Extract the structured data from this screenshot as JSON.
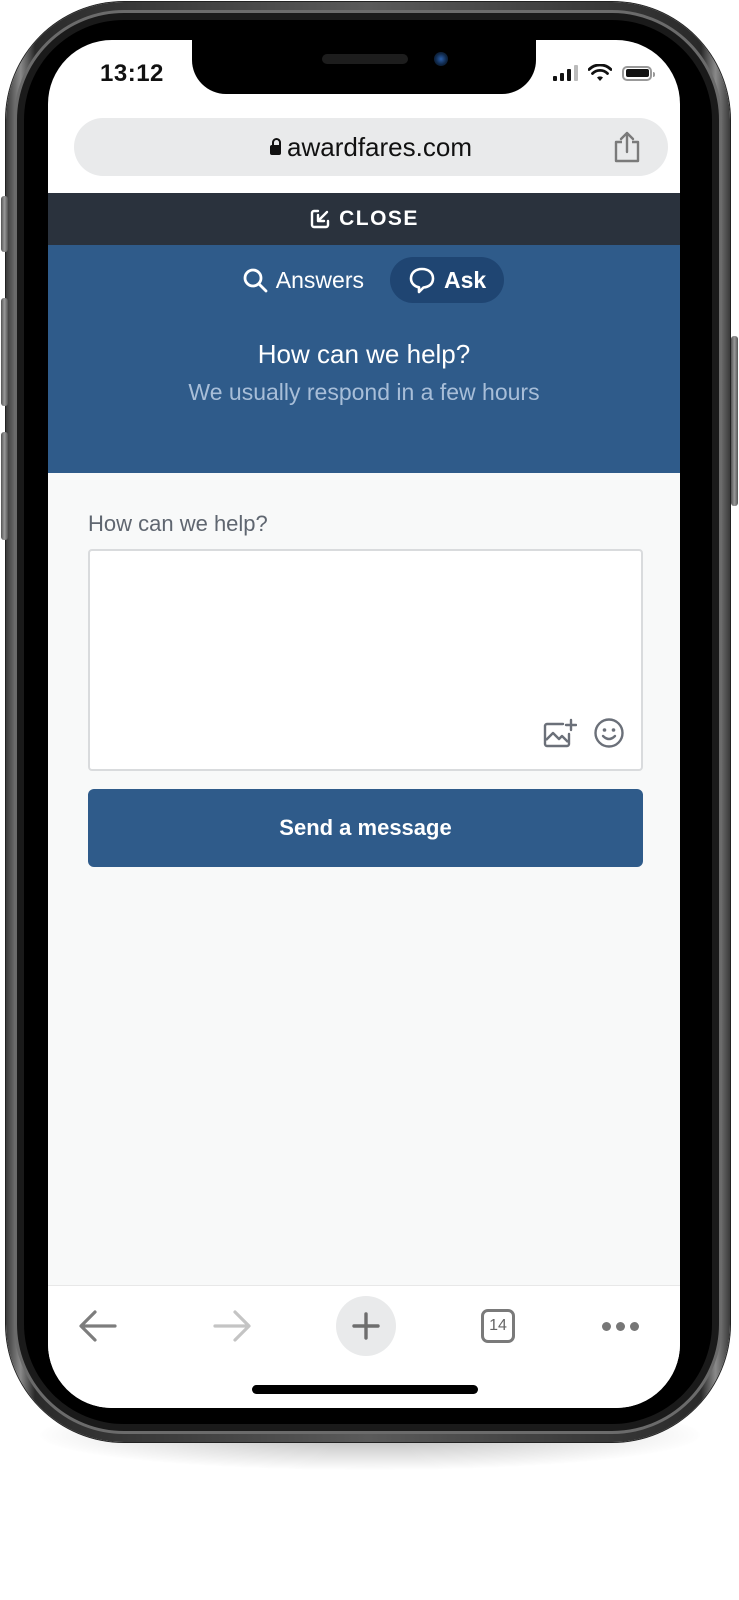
{
  "status_bar": {
    "time": "13:12",
    "signal_bars_active": 3,
    "signal_bars_total": 4,
    "battery_level": 0.9,
    "icons": [
      "signal-icon",
      "wifi-icon",
      "battery-icon"
    ]
  },
  "browser": {
    "url": "awardfares.com",
    "secure_icon": "lock-icon",
    "share_icon": "share-icon",
    "open_tabs_count": "14",
    "toolbar_icons": [
      "back-arrow-icon",
      "forward-arrow-icon",
      "plus-icon",
      "tabs-icon",
      "more-dots-icon"
    ]
  },
  "widget": {
    "close_label": "CLOSE",
    "close_icon": "minimize-arrow-icon",
    "tabs": [
      {
        "label": "Answers",
        "icon": "search-icon",
        "active": false
      },
      {
        "label": "Ask",
        "icon": "chat-bubble-icon",
        "active": true
      }
    ],
    "header_title": "How can we help?",
    "header_subtitle": "We usually respond in a few hours",
    "form": {
      "label": "How can we help?",
      "message_value": "",
      "message_placeholder": "",
      "attach_icon": "add-image-icon",
      "emoji_icon": "emoji-icon",
      "submit_label": "Send a message"
    }
  },
  "colors": {
    "brand_blue": "#2f5b8a",
    "active_tab": "#1f4572",
    "close_bar": "#2a323d",
    "subtitle": "#a8bed8",
    "content_bg": "#f8f9f9"
  }
}
